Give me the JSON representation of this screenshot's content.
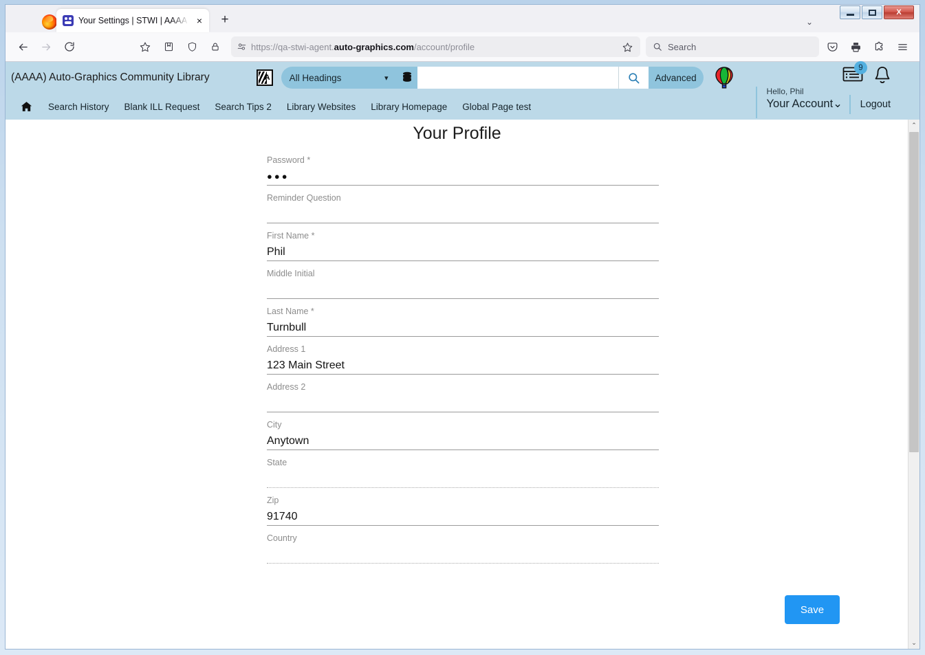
{
  "window": {
    "minimize_label": "Minimize",
    "maximize_label": "Maximize",
    "close_label": "X"
  },
  "browser": {
    "tab": {
      "title": "Your Settings | STWI | AAAA | Au",
      "close_label": "×"
    },
    "new_tab_label": "+",
    "tab_list_chevron": "⌄",
    "url": {
      "prefix": "https://qa-stwi-agent.",
      "domain": "auto-graphics.com",
      "path": "/account/profile"
    },
    "search_placeholder": "Search"
  },
  "app_header": {
    "library_name": "(AAAA) Auto-Graphics Community Library",
    "heading_filter": "All Headings",
    "search_value": "",
    "advanced_label": "Advanced",
    "notifications_badge": "9",
    "greeting": "Hello, Phil",
    "account_label": "Your Account",
    "account_chevron": "⌄",
    "logout_label": "Logout",
    "nav_links": [
      "Search History",
      "Blank ILL Request",
      "Search Tips 2",
      "Library Websites",
      "Library Homepage",
      "Global Page test"
    ]
  },
  "page": {
    "title": "Your Profile",
    "save_label": "Save",
    "fields": [
      {
        "label": "Password *",
        "value": "●●●",
        "masked": true,
        "underline": "solid"
      },
      {
        "label": "Reminder Question",
        "value": "",
        "masked": false,
        "underline": "solid"
      },
      {
        "label": "First Name *",
        "value": "Phil",
        "masked": false,
        "underline": "solid"
      },
      {
        "label": "Middle Initial",
        "value": "",
        "masked": false,
        "underline": "solid"
      },
      {
        "label": "Last Name *",
        "value": "Turnbull",
        "masked": false,
        "underline": "solid"
      },
      {
        "label": "Address 1",
        "value": "123 Main Street",
        "masked": false,
        "underline": "solid"
      },
      {
        "label": "Address 2",
        "value": "",
        "masked": false,
        "underline": "solid"
      },
      {
        "label": "City",
        "value": "Anytown",
        "masked": false,
        "underline": "solid"
      },
      {
        "label": "State",
        "value": "",
        "masked": false,
        "underline": "dotted"
      },
      {
        "label": "Zip",
        "value": "91740",
        "masked": false,
        "underline": "solid"
      },
      {
        "label": "Country",
        "value": "",
        "masked": false,
        "underline": "dotted"
      }
    ]
  },
  "scrollbar": {
    "up_arrow": "⌃",
    "down_arrow": "⌄"
  },
  "colors": {
    "app_header_bg": "#bcd9e8",
    "accent_blue": "#8fc4dd",
    "save_button": "#2196f3",
    "badge": "#53b0e0"
  }
}
